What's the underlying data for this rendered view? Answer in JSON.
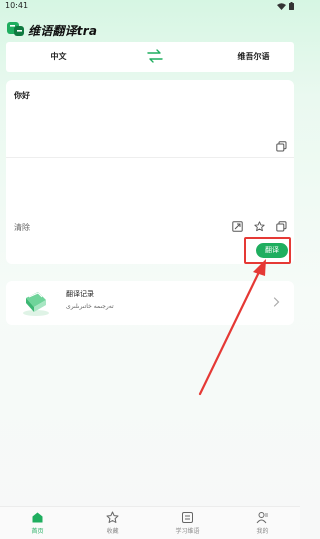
{
  "status_bar": {
    "time": "10:41"
  },
  "header": {
    "title": "维语翻译tra"
  },
  "lang_bar": {
    "source": "中文",
    "target": "维吾尔语",
    "swap_icon": "swap-arrows-icon"
  },
  "translator": {
    "source_text": "你好",
    "clear_label": "清除",
    "translate_label": "翻译"
  },
  "history": {
    "title": "翻译记录",
    "subtitle": "تەرجىمە خاتىرىلىرى"
  },
  "bottom_nav": {
    "items": [
      {
        "label": "首页",
        "icon": "home-icon",
        "active": true
      },
      {
        "label": "收藏",
        "icon": "star-icon",
        "active": false
      },
      {
        "label": "学习维语",
        "icon": "book-icon",
        "active": false
      },
      {
        "label": "我的",
        "icon": "user-icon",
        "active": false
      }
    ]
  },
  "colors": {
    "accent": "#1fae5f",
    "annotation": "#e53935"
  }
}
